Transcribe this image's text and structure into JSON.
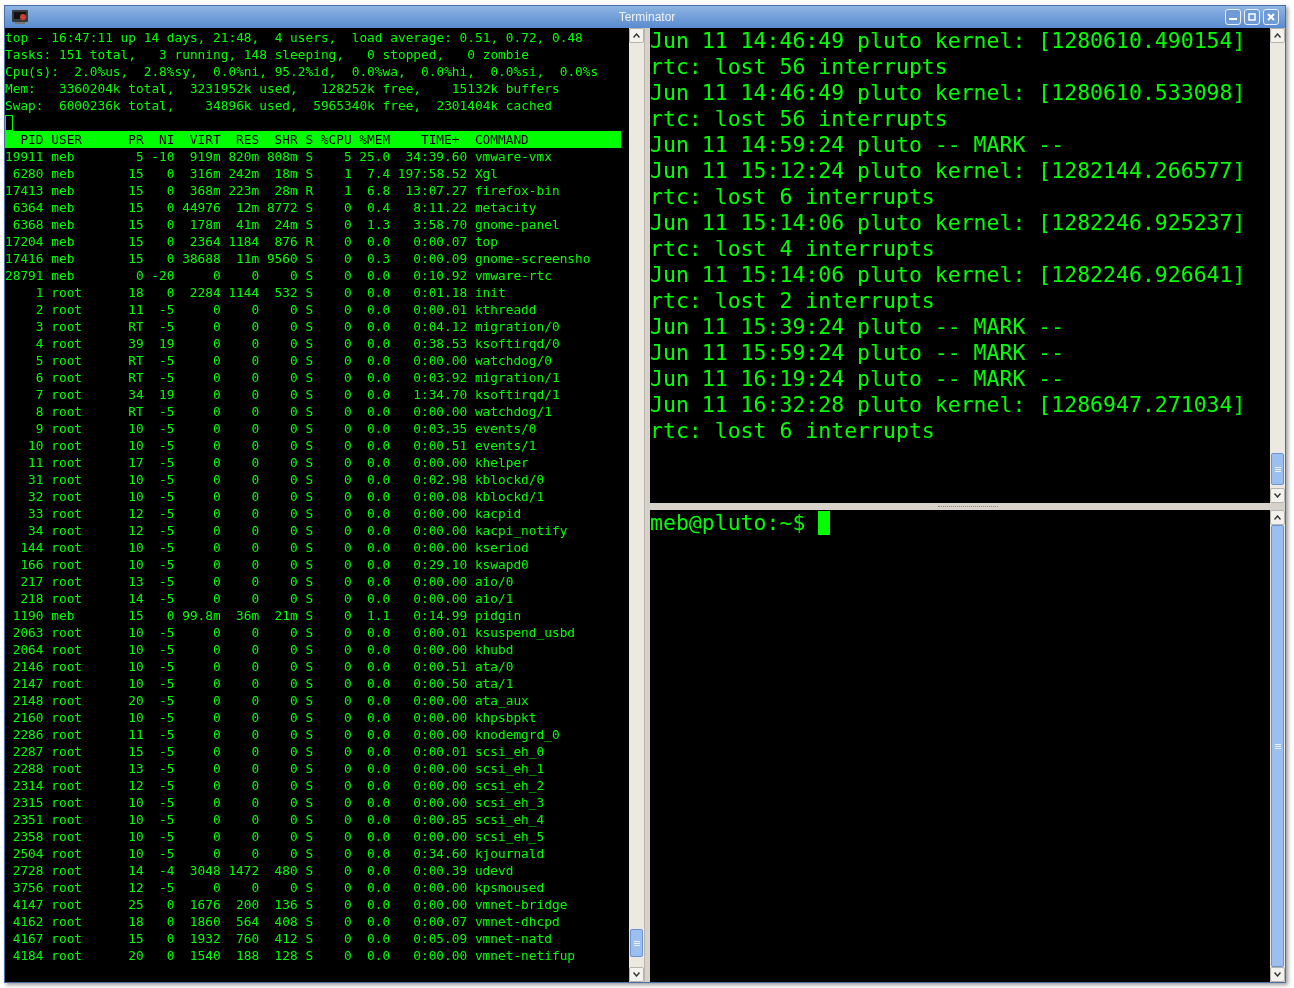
{
  "window": {
    "title": "Terminator"
  },
  "left_terminal": {
    "summary_lines": [
      "top - 16:47:11 up 14 days, 21:48,  4 users,  load average: 0.51, 0.72, 0.48",
      "Tasks: 151 total,   3 running, 148 sleeping,   0 stopped,   0 zombie",
      "Cpu(s):  2.0%us,  2.8%sy,  0.0%ni, 95.2%id,  0.0%wa,  0.0%hi,  0.0%si,  0.0%s",
      "Mem:   3360204k total,  3231952k used,   128252k free,    15132k buffers",
      "Swap:  6000236k total,    34896k used,  5965340k free,  2301404k cached"
    ],
    "process_table": {
      "columns": [
        "PID",
        "USER",
        "PR",
        "NI",
        "VIRT",
        "RES",
        "SHR",
        "S",
        "%CPU",
        "%MEM",
        "TIME+",
        "COMMAND"
      ],
      "rows": [
        [
          "19911",
          "meb",
          "5",
          "-10",
          "919m",
          "820m",
          "808m",
          "S",
          "5",
          "25.0",
          "34:39.60",
          "vmware-vmx"
        ],
        [
          "6280",
          "meb",
          "15",
          "0",
          "316m",
          "242m",
          "18m",
          "S",
          "1",
          "7.4",
          "197:58.52",
          "Xgl"
        ],
        [
          "17413",
          "meb",
          "15",
          "0",
          "368m",
          "223m",
          "28m",
          "R",
          "1",
          "6.8",
          "13:07.27",
          "firefox-bin"
        ],
        [
          "6364",
          "meb",
          "15",
          "0",
          "44976",
          "12m",
          "8772",
          "S",
          "0",
          "0.4",
          "8:11.22",
          "metacity"
        ],
        [
          "6368",
          "meb",
          "15",
          "0",
          "178m",
          "41m",
          "24m",
          "S",
          "0",
          "1.3",
          "3:58.70",
          "gnome-panel"
        ],
        [
          "17204",
          "meb",
          "15",
          "0",
          "2364",
          "1184",
          "876",
          "R",
          "0",
          "0.0",
          "0:00.07",
          "top"
        ],
        [
          "17416",
          "meb",
          "15",
          "0",
          "38688",
          "11m",
          "9560",
          "S",
          "0",
          "0.3",
          "0:00.09",
          "gnome-screensho"
        ],
        [
          "28791",
          "meb",
          "0",
          "-20",
          "0",
          "0",
          "0",
          "S",
          "0",
          "0.0",
          "0:10.92",
          "vmware-rtc"
        ],
        [
          "1",
          "root",
          "18",
          "0",
          "2284",
          "1144",
          "532",
          "S",
          "0",
          "0.0",
          "0:01.18",
          "init"
        ],
        [
          "2",
          "root",
          "11",
          "-5",
          "0",
          "0",
          "0",
          "S",
          "0",
          "0.0",
          "0:00.01",
          "kthreadd"
        ],
        [
          "3",
          "root",
          "RT",
          "-5",
          "0",
          "0",
          "0",
          "S",
          "0",
          "0.0",
          "0:04.12",
          "migration/0"
        ],
        [
          "4",
          "root",
          "39",
          "19",
          "0",
          "0",
          "0",
          "S",
          "0",
          "0.0",
          "0:38.53",
          "ksoftirqd/0"
        ],
        [
          "5",
          "root",
          "RT",
          "-5",
          "0",
          "0",
          "0",
          "S",
          "0",
          "0.0",
          "0:00.00",
          "watchdog/0"
        ],
        [
          "6",
          "root",
          "RT",
          "-5",
          "0",
          "0",
          "0",
          "S",
          "0",
          "0.0",
          "0:03.92",
          "migration/1"
        ],
        [
          "7",
          "root",
          "34",
          "19",
          "0",
          "0",
          "0",
          "S",
          "0",
          "0.0",
          "1:34.70",
          "ksoftirqd/1"
        ],
        [
          "8",
          "root",
          "RT",
          "-5",
          "0",
          "0",
          "0",
          "S",
          "0",
          "0.0",
          "0:00.00",
          "watchdog/1"
        ],
        [
          "9",
          "root",
          "10",
          "-5",
          "0",
          "0",
          "0",
          "S",
          "0",
          "0.0",
          "0:03.35",
          "events/0"
        ],
        [
          "10",
          "root",
          "10",
          "-5",
          "0",
          "0",
          "0",
          "S",
          "0",
          "0.0",
          "0:00.51",
          "events/1"
        ],
        [
          "11",
          "root",
          "17",
          "-5",
          "0",
          "0",
          "0",
          "S",
          "0",
          "0.0",
          "0:00.00",
          "khelper"
        ],
        [
          "31",
          "root",
          "10",
          "-5",
          "0",
          "0",
          "0",
          "S",
          "0",
          "0.0",
          "0:02.98",
          "kblockd/0"
        ],
        [
          "32",
          "root",
          "10",
          "-5",
          "0",
          "0",
          "0",
          "S",
          "0",
          "0.0",
          "0:00.08",
          "kblockd/1"
        ],
        [
          "33",
          "root",
          "12",
          "-5",
          "0",
          "0",
          "0",
          "S",
          "0",
          "0.0",
          "0:00.00",
          "kacpid"
        ],
        [
          "34",
          "root",
          "12",
          "-5",
          "0",
          "0",
          "0",
          "S",
          "0",
          "0.0",
          "0:00.00",
          "kacpi_notify"
        ],
        [
          "144",
          "root",
          "10",
          "-5",
          "0",
          "0",
          "0",
          "S",
          "0",
          "0.0",
          "0:00.00",
          "kseriod"
        ],
        [
          "166",
          "root",
          "10",
          "-5",
          "0",
          "0",
          "0",
          "S",
          "0",
          "0.0",
          "0:29.10",
          "kswapd0"
        ],
        [
          "217",
          "root",
          "13",
          "-5",
          "0",
          "0",
          "0",
          "S",
          "0",
          "0.0",
          "0:00.00",
          "aio/0"
        ],
        [
          "218",
          "root",
          "14",
          "-5",
          "0",
          "0",
          "0",
          "S",
          "0",
          "0.0",
          "0:00.00",
          "aio/1"
        ],
        [
          "1190",
          "meb",
          "15",
          "0",
          "99.8m",
          "36m",
          "21m",
          "S",
          "0",
          "1.1",
          "0:14.99",
          "pidgin"
        ],
        [
          "2063",
          "root",
          "10",
          "-5",
          "0",
          "0",
          "0",
          "S",
          "0",
          "0.0",
          "0:00.01",
          "ksuspend_usbd"
        ],
        [
          "2064",
          "root",
          "10",
          "-5",
          "0",
          "0",
          "0",
          "S",
          "0",
          "0.0",
          "0:00.00",
          "khubd"
        ],
        [
          "2146",
          "root",
          "10",
          "-5",
          "0",
          "0",
          "0",
          "S",
          "0",
          "0.0",
          "0:00.51",
          "ata/0"
        ],
        [
          "2147",
          "root",
          "10",
          "-5",
          "0",
          "0",
          "0",
          "S",
          "0",
          "0.0",
          "0:00.50",
          "ata/1"
        ],
        [
          "2148",
          "root",
          "20",
          "-5",
          "0",
          "0",
          "0",
          "S",
          "0",
          "0.0",
          "0:00.00",
          "ata_aux"
        ],
        [
          "2160",
          "root",
          "10",
          "-5",
          "0",
          "0",
          "0",
          "S",
          "0",
          "0.0",
          "0:00.00",
          "khpsbpkt"
        ],
        [
          "2286",
          "root",
          "11",
          "-5",
          "0",
          "0",
          "0",
          "S",
          "0",
          "0.0",
          "0:00.00",
          "knodemgrd_0"
        ],
        [
          "2287",
          "root",
          "15",
          "-5",
          "0",
          "0",
          "0",
          "S",
          "0",
          "0.0",
          "0:00.01",
          "scsi_eh_0"
        ],
        [
          "2288",
          "root",
          "13",
          "-5",
          "0",
          "0",
          "0",
          "S",
          "0",
          "0.0",
          "0:00.00",
          "scsi_eh_1"
        ],
        [
          "2314",
          "root",
          "12",
          "-5",
          "0",
          "0",
          "0",
          "S",
          "0",
          "0.0",
          "0:00.00",
          "scsi_eh_2"
        ],
        [
          "2315",
          "root",
          "10",
          "-5",
          "0",
          "0",
          "0",
          "S",
          "0",
          "0.0",
          "0:00.00",
          "scsi_eh_3"
        ],
        [
          "2351",
          "root",
          "10",
          "-5",
          "0",
          "0",
          "0",
          "S",
          "0",
          "0.0",
          "0:00.85",
          "scsi_eh_4"
        ],
        [
          "2358",
          "root",
          "10",
          "-5",
          "0",
          "0",
          "0",
          "S",
          "0",
          "0.0",
          "0:00.00",
          "scsi_eh_5"
        ],
        [
          "2504",
          "root",
          "10",
          "-5",
          "0",
          "0",
          "0",
          "S",
          "0",
          "0.0",
          "0:34.60",
          "kjournald"
        ],
        [
          "2728",
          "root",
          "14",
          "-4",
          "3048",
          "1472",
          "480",
          "S",
          "0",
          "0.0",
          "0:00.39",
          "udevd"
        ],
        [
          "3756",
          "root",
          "12",
          "-5",
          "0",
          "0",
          "0",
          "S",
          "0",
          "0.0",
          "0:00.00",
          "kpsmoused"
        ],
        [
          "4147",
          "root",
          "25",
          "0",
          "1676",
          "200",
          "136",
          "S",
          "0",
          "0.0",
          "0:00.00",
          "vmnet-bridge"
        ],
        [
          "4162",
          "root",
          "18",
          "0",
          "1860",
          "564",
          "408",
          "S",
          "0",
          "0.0",
          "0:00.07",
          "vmnet-dhcpd"
        ],
        [
          "4167",
          "root",
          "15",
          "0",
          "1932",
          "760",
          "412",
          "S",
          "0",
          "0.0",
          "0:05.09",
          "vmnet-natd"
        ],
        [
          "4184",
          "root",
          "20",
          "0",
          "1540",
          "188",
          "128",
          "S",
          "0",
          "0.0",
          "0:00.00",
          "vmnet-netifup"
        ]
      ]
    }
  },
  "right_top_terminal": {
    "lines": [
      "Jun 11 14:46:49 pluto kernel: [1280610.490154]",
      "rtc: lost 56 interrupts",
      "Jun 11 14:46:49 pluto kernel: [1280610.533098]",
      "rtc: lost 56 interrupts",
      "Jun 11 14:59:24 pluto -- MARK --",
      "Jun 11 15:12:24 pluto kernel: [1282144.266577]",
      "rtc: lost 6 interrupts",
      "Jun 11 15:14:06 pluto kernel: [1282246.925237]",
      "rtc: lost 4 interrupts",
      "Jun 11 15:14:06 pluto kernel: [1282246.926641]",
      "rtc: lost 2 interrupts",
      "Jun 11 15:39:24 pluto -- MARK --",
      "Jun 11 15:59:24 pluto -- MARK --",
      "Jun 11 16:19:24 pluto -- MARK --",
      "Jun 11 16:32:28 pluto kernel: [1286947.271034]",
      "rtc: lost 6 interrupts"
    ]
  },
  "right_bottom_terminal": {
    "prompt": "meb@pluto:~$"
  }
}
